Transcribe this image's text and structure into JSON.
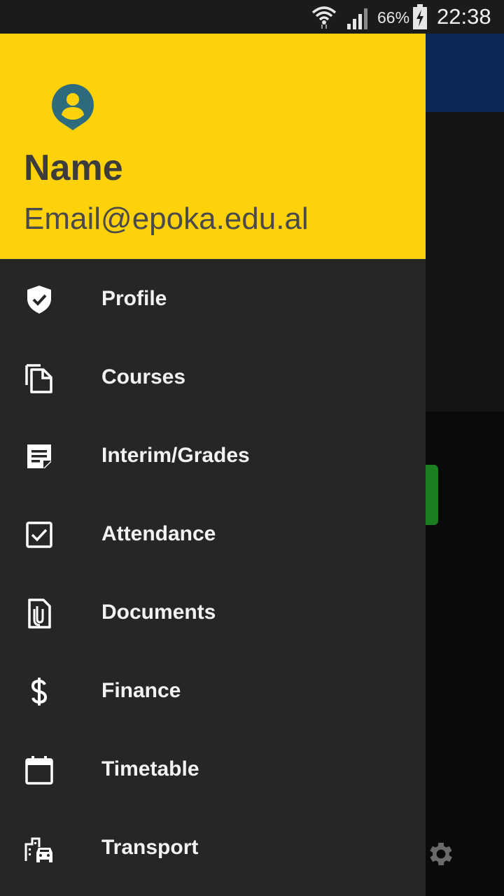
{
  "status_bar": {
    "battery_percent": "66%",
    "time": "22:38",
    "signal_icon": "cellular-signal-icon",
    "wifi_icon": "wifi-icon",
    "battery_icon": "battery-charging-icon"
  },
  "drawer": {
    "header": {
      "avatar_icon": "account-pin-icon",
      "name": "Name",
      "email": "Email@epoka.edu.al"
    },
    "items": [
      {
        "label": "Profile",
        "icon": "shield-check-icon"
      },
      {
        "label": "Courses",
        "icon": "copy-documents-icon"
      },
      {
        "label": "Interim/Grades",
        "icon": "note-icon"
      },
      {
        "label": "Attendance",
        "icon": "checkbox-icon"
      },
      {
        "label": "Documents",
        "icon": "attachment-file-icon"
      },
      {
        "label": "Finance",
        "icon": "dollar-icon"
      },
      {
        "label": "Timetable",
        "icon": "calendar-icon"
      },
      {
        "label": "Transport",
        "icon": "commute-icon"
      }
    ]
  },
  "colors": {
    "drawer_header": "#fed20b",
    "drawer_background": "#262626",
    "app_bar": "#0c2955",
    "avatar": "#2e6b7d"
  }
}
